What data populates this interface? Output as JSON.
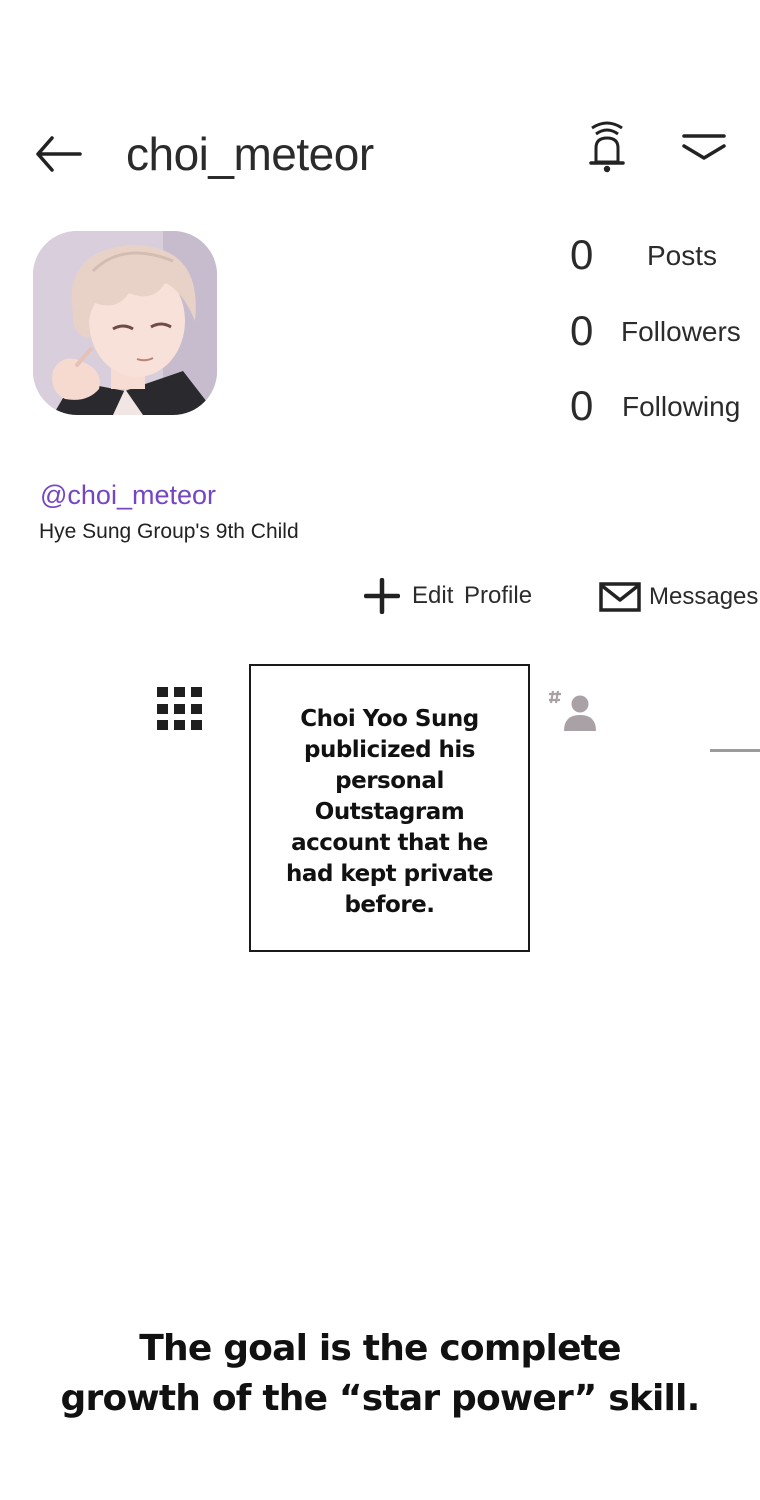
{
  "header": {
    "username": "choi_meteor",
    "back_icon": "arrow-left-icon",
    "notification_icon": "bell-icon",
    "menu_icon": "chevron-down-icon"
  },
  "profile": {
    "avatar_icon": "avatar-illustration",
    "handle": "@choi_meteor",
    "bio": "Hye Sung Group's 9th Child",
    "handle_color": "#7446c2"
  },
  "stats": {
    "posts": {
      "count": "0",
      "label": "Posts"
    },
    "followers": {
      "count": "0",
      "label": "Followers"
    },
    "following": {
      "count": "0",
      "label": "Following"
    }
  },
  "actions": {
    "edit_profile": "Edit Profile",
    "messages": "Messages",
    "edit_icon": "plus-icon",
    "messages_icon": "envelope-icon"
  },
  "tabs": {
    "grid_icon": "grid-icon",
    "tagged_icon": "tagged-person-icon"
  },
  "narration": {
    "box_text": "Choi Yoo Sung publicized his personal Outstagram account that he had kept private before.",
    "caption_line1": "The goal is the complete",
    "caption_line2": "growth of the “star power” skill."
  }
}
